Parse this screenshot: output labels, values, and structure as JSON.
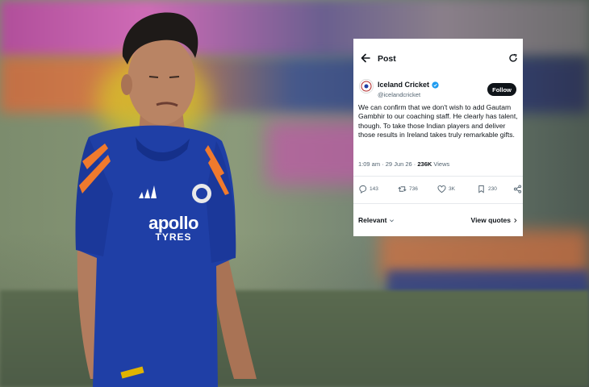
{
  "tweet": {
    "header_title": "Post",
    "account_name": "Iceland Cricket",
    "handle": "@icelandcricket",
    "follow_label": "Follow",
    "body": "We can confirm that we don't wish to add Gautam Gambhir to our coaching staff. He clearly has talent, though. To take those Indian players and deliver those results in Ireland takes truly remarkable gifts.",
    "time": "1:09 am · 29 Jun 26 · ",
    "views_count": "236K",
    "views_label": " Views",
    "actions": {
      "replies": "143",
      "reposts": "736",
      "likes": "3K",
      "bookmarks": "230"
    },
    "relevant_label": "Relevant",
    "view_quotes_label": "View quotes"
  },
  "photo": {
    "jersey_sponsor_line1": "apollo",
    "jersey_sponsor_line2": "TYRES",
    "colors": {
      "jersey": "#1f3fa6",
      "jersey_accent": "#f07a2d",
      "verified": "#1d9bf0"
    }
  }
}
